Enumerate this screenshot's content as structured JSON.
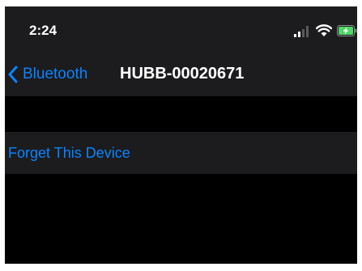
{
  "status_bar": {
    "time": "2:24",
    "icons": [
      "signal-icon",
      "wifi-icon",
      "charging-battery-icon"
    ]
  },
  "nav": {
    "back_label": "Bluetooth",
    "title": "HUBB-00020671"
  },
  "list": {
    "forget_label": "Forget This Device"
  },
  "colors": {
    "background": "#000000",
    "bar_background": "#1c1c1e",
    "accent": "#0a84ff",
    "battery_charging": "#4cd964",
    "text": "#ffffff"
  }
}
